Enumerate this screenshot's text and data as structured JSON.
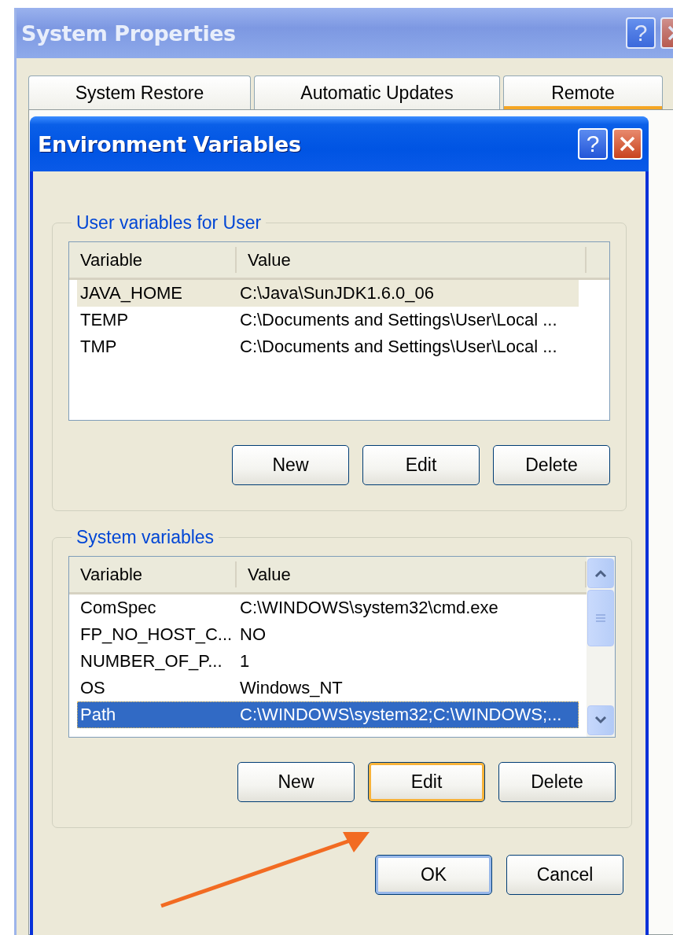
{
  "outer_window": {
    "title": "System Properties",
    "help_glyph": "?",
    "tabs": [
      {
        "label": "System Restore",
        "selected": false
      },
      {
        "label": "Automatic Updates",
        "selected": false
      },
      {
        "label": "Remote",
        "selected": true
      }
    ]
  },
  "dialog": {
    "title": "Environment Variables",
    "help_glyph": "?",
    "groups": [
      {
        "label": "User variables for User",
        "active": false,
        "scrollbar": false,
        "columns": [
          "Variable",
          "Value"
        ],
        "rows": [
          {
            "variable": "JAVA_HOME",
            "value": "C:\\Java\\SunJDK1.6.0_06",
            "selected": true
          },
          {
            "variable": "TEMP",
            "value": "C:\\Documents and Settings\\User\\Local ...",
            "selected": false
          },
          {
            "variable": "TMP",
            "value": "C:\\Documents and Settings\\User\\Local ...",
            "selected": false
          }
        ],
        "buttons": [
          {
            "label": "New",
            "focused": false
          },
          {
            "label": "Edit",
            "focused": false
          },
          {
            "label": "Delete",
            "focused": false
          }
        ]
      },
      {
        "label": "System variables",
        "active": true,
        "scrollbar": true,
        "columns": [
          "Variable",
          "Value"
        ],
        "rows": [
          {
            "variable": "ComSpec",
            "value": "C:\\WINDOWS\\system32\\cmd.exe",
            "selected": false
          },
          {
            "variable": "FP_NO_HOST_C...",
            "value": "NO",
            "selected": false
          },
          {
            "variable": "NUMBER_OF_P...",
            "value": "1",
            "selected": false
          },
          {
            "variable": "OS",
            "value": "Windows_NT",
            "selected": false
          },
          {
            "variable": "Path",
            "value": "C:\\WINDOWS\\system32;C:\\WINDOWS;...",
            "selected": true
          }
        ],
        "buttons": [
          {
            "label": "New",
            "focused": false
          },
          {
            "label": "Edit",
            "focused": true
          },
          {
            "label": "Delete",
            "focused": false
          }
        ]
      }
    ],
    "buttons": [
      {
        "label": "OK",
        "default": true
      },
      {
        "label": "Cancel",
        "default": false
      }
    ]
  }
}
